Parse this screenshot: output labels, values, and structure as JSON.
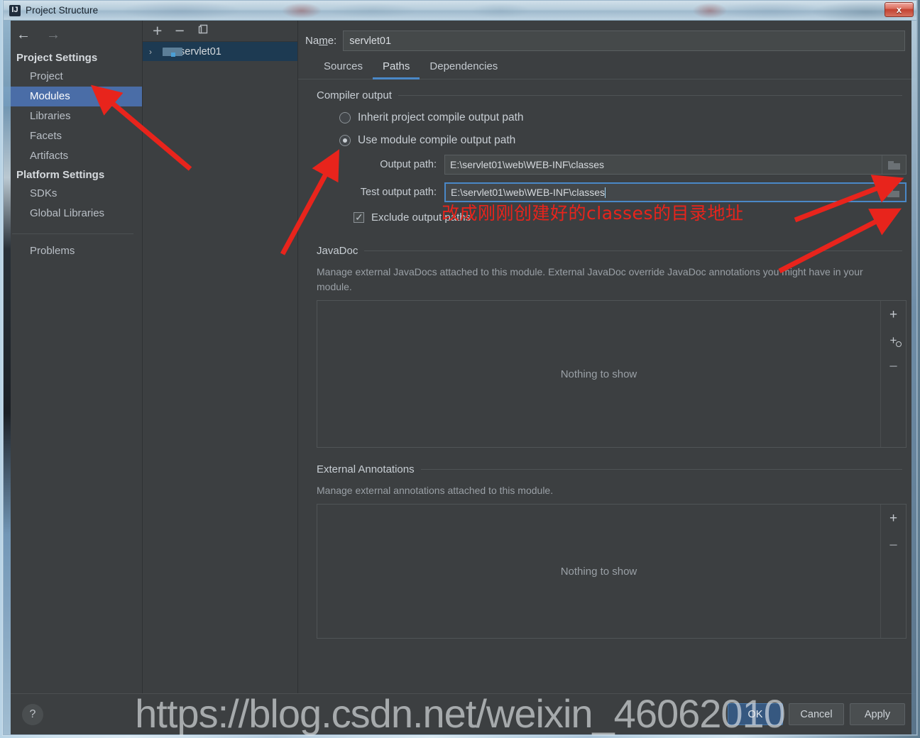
{
  "window": {
    "title": "Project Structure",
    "app_icon": "intellij-idea-icon",
    "close_label": "x"
  },
  "sidebar": {
    "back_icon": "←",
    "forward_icon": "→",
    "groups": [
      {
        "title": "Project Settings",
        "items": [
          {
            "label": "Project",
            "selected": false
          },
          {
            "label": "Modules",
            "selected": true
          },
          {
            "label": "Libraries",
            "selected": false
          },
          {
            "label": "Facets",
            "selected": false
          },
          {
            "label": "Artifacts",
            "selected": false
          }
        ]
      },
      {
        "title": "Platform Settings",
        "items": [
          {
            "label": "SDKs",
            "selected": false
          },
          {
            "label": "Global Libraries",
            "selected": false
          }
        ]
      }
    ],
    "problems_label": "Problems"
  },
  "modules_panel": {
    "toolbar": {
      "add_label": "+",
      "remove_label": "−",
      "copy_label": "copy-icon"
    },
    "tree": [
      {
        "label": "servlet01",
        "expand_icon": "›",
        "icon": "module-folder-icon",
        "selected": true
      }
    ]
  },
  "main": {
    "name_label_pre": "Na",
    "name_label_mnemonic": "m",
    "name_label_post": "e:",
    "name_value": "servlet01",
    "tabs": [
      {
        "label": "Sources",
        "active": false
      },
      {
        "label": "Paths",
        "active": true
      },
      {
        "label": "Dependencies",
        "active": false
      }
    ],
    "compiler_output": {
      "section_title": "Compiler output",
      "radio_inherit": "Inherit project compile output path",
      "radio_module": "Use module compile output path",
      "radio_selected": "module",
      "output_path_label": "Output path:",
      "output_path_value": "E:\\servlet01\\web\\WEB-INF\\classes",
      "test_output_path_label": "Test output path:",
      "test_output_path_value": "E:\\servlet01\\web\\WEB-INF\\classes",
      "browse_icon": "folder-browse-icon",
      "exclude_label": "Exclude output paths",
      "exclude_checked": true
    },
    "javadoc": {
      "section_title": "JavaDoc",
      "description": "Manage external JavaDocs attached to this module. External JavaDoc override JavaDoc annotations you might have in your module.",
      "empty_text": "Nothing to show",
      "buttons": [
        "+",
        "+url",
        "−"
      ]
    },
    "external_annotations": {
      "section_title": "External Annotations",
      "description": "Manage external annotations attached to this module.",
      "empty_text": "Nothing to show",
      "buttons": [
        "+",
        "−"
      ]
    }
  },
  "bottom": {
    "help_label": "?",
    "ok_label": "OK",
    "cancel_label": "Cancel",
    "apply_label": "Apply"
  },
  "annotations": {
    "chinese_note": "改成刚刚创建好的classes的目录地址",
    "arrow_color": "#e8241c"
  },
  "watermark": {
    "text": "https://blog.csdn.net/weixin_46062010"
  },
  "colors": {
    "window_bg": "#3c3f41",
    "selection_blue": "#4a6da7",
    "tab_underline": "#4a88c7",
    "tree_selection": "#1d3a52",
    "default_button": "#365880",
    "annotation_red": "#e8241c"
  }
}
